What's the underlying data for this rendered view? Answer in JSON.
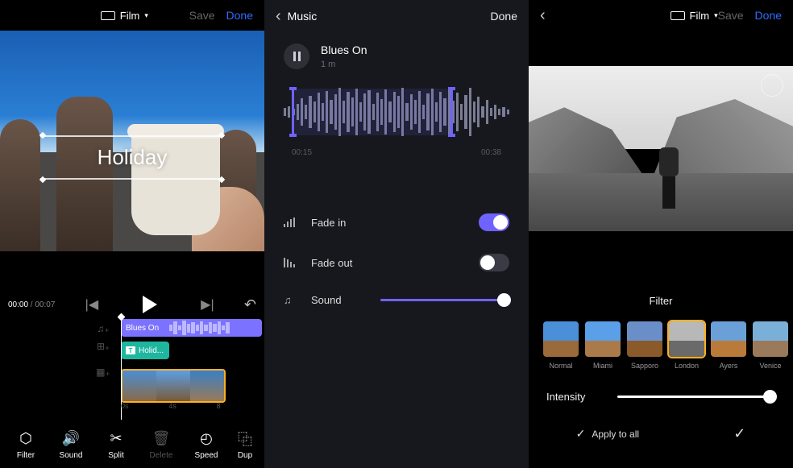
{
  "pane1": {
    "film_label": "Film",
    "save": "Save",
    "done": "Done",
    "overlay_title": "Holiday",
    "time_current": "00:00",
    "time_sep": " / ",
    "time_total": "00:07",
    "track_music_label": "Blues On",
    "track_title_label": "Holid...",
    "ruler": {
      "t0": "0s",
      "t4": "4s",
      "t8": "8"
    },
    "tools": {
      "filter": "Filter",
      "sound": "Sound",
      "split": "Split",
      "delete": "Delete",
      "speed": "Speed",
      "dup": "Dup"
    }
  },
  "pane2": {
    "header": "Music",
    "done": "Done",
    "song_name": "Blues On",
    "song_duration": "1 m",
    "wave_start": "00:15",
    "wave_end": "00:38",
    "fade_in": "Fade in",
    "fade_out": "Fade out",
    "sound": "Sound",
    "fade_in_on": true,
    "fade_out_on": false,
    "sound_value": 100
  },
  "pane3": {
    "film_label": "Film",
    "save": "Save",
    "done": "Done",
    "section": "Filter",
    "filters": [
      {
        "key": "normal",
        "label": "Normal"
      },
      {
        "key": "miami",
        "label": "Miami"
      },
      {
        "key": "sapporo",
        "label": "Sapporo"
      },
      {
        "key": "london",
        "label": "London",
        "selected": true
      },
      {
        "key": "ayers",
        "label": "Ayers"
      },
      {
        "key": "venice",
        "label": "Venice"
      }
    ],
    "intensity_label": "Intensity",
    "intensity_value": 100,
    "apply_all": "Apply to all"
  }
}
